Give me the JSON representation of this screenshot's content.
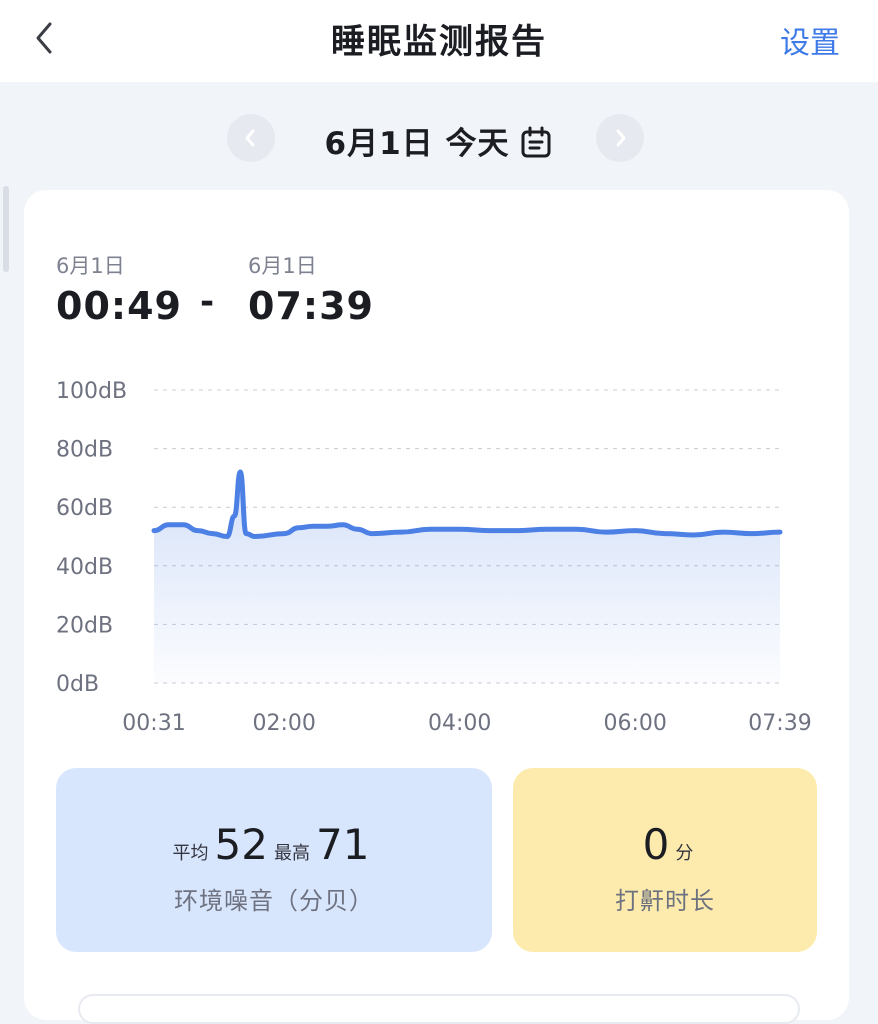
{
  "header": {
    "title": "睡眠监测报告",
    "settings_label": "设置"
  },
  "date_nav": {
    "date_text": "6月1日 今天"
  },
  "session": {
    "start_date": "6月1日",
    "start_time": "00:49",
    "separator": "-",
    "end_date": "6月1日",
    "end_time": "07:39"
  },
  "chart_data": {
    "type": "area",
    "title": "",
    "xlabel": "",
    "ylabel": "",
    "ylim": [
      0,
      100
    ],
    "y_ticks": [
      "100dB",
      "80dB",
      "60dB",
      "40dB",
      "20dB",
      "0dB"
    ],
    "x_ticks": [
      "00:31",
      "02:00",
      "04:00",
      "06:00",
      "07:39"
    ],
    "grid": true,
    "series": [
      {
        "x": [
          "00:31",
          "00:41",
          "00:51",
          "01:01",
          "01:11",
          "01:21",
          "01:26",
          "01:30",
          "01:34",
          "01:40",
          "02:00",
          "02:10",
          "02:20",
          "02:30",
          "02:40",
          "02:50",
          "03:00",
          "03:20",
          "03:40",
          "04:00",
          "04:20",
          "04:40",
          "05:00",
          "05:20",
          "05:40",
          "06:00",
          "06:20",
          "06:40",
          "07:00",
          "07:20",
          "07:39"
        ],
        "values": [
          52,
          54,
          54,
          52,
          51,
          50,
          57,
          72,
          51,
          50,
          51,
          53,
          53.5,
          53.5,
          54,
          52.5,
          51,
          51.5,
          52.5,
          52.5,
          52,
          52,
          52.5,
          52.5,
          51.5,
          52,
          51,
          50.5,
          51.5,
          51,
          51.5
        ]
      }
    ],
    "color": "#4d80e4"
  },
  "noise_stats": {
    "avg_label": "平均",
    "avg_value": "52",
    "max_label": "最高",
    "max_value": "71",
    "caption": "环境噪音（分贝）"
  },
  "snore_stats": {
    "value": "0",
    "unit": "分",
    "caption": "打鼾时长"
  }
}
